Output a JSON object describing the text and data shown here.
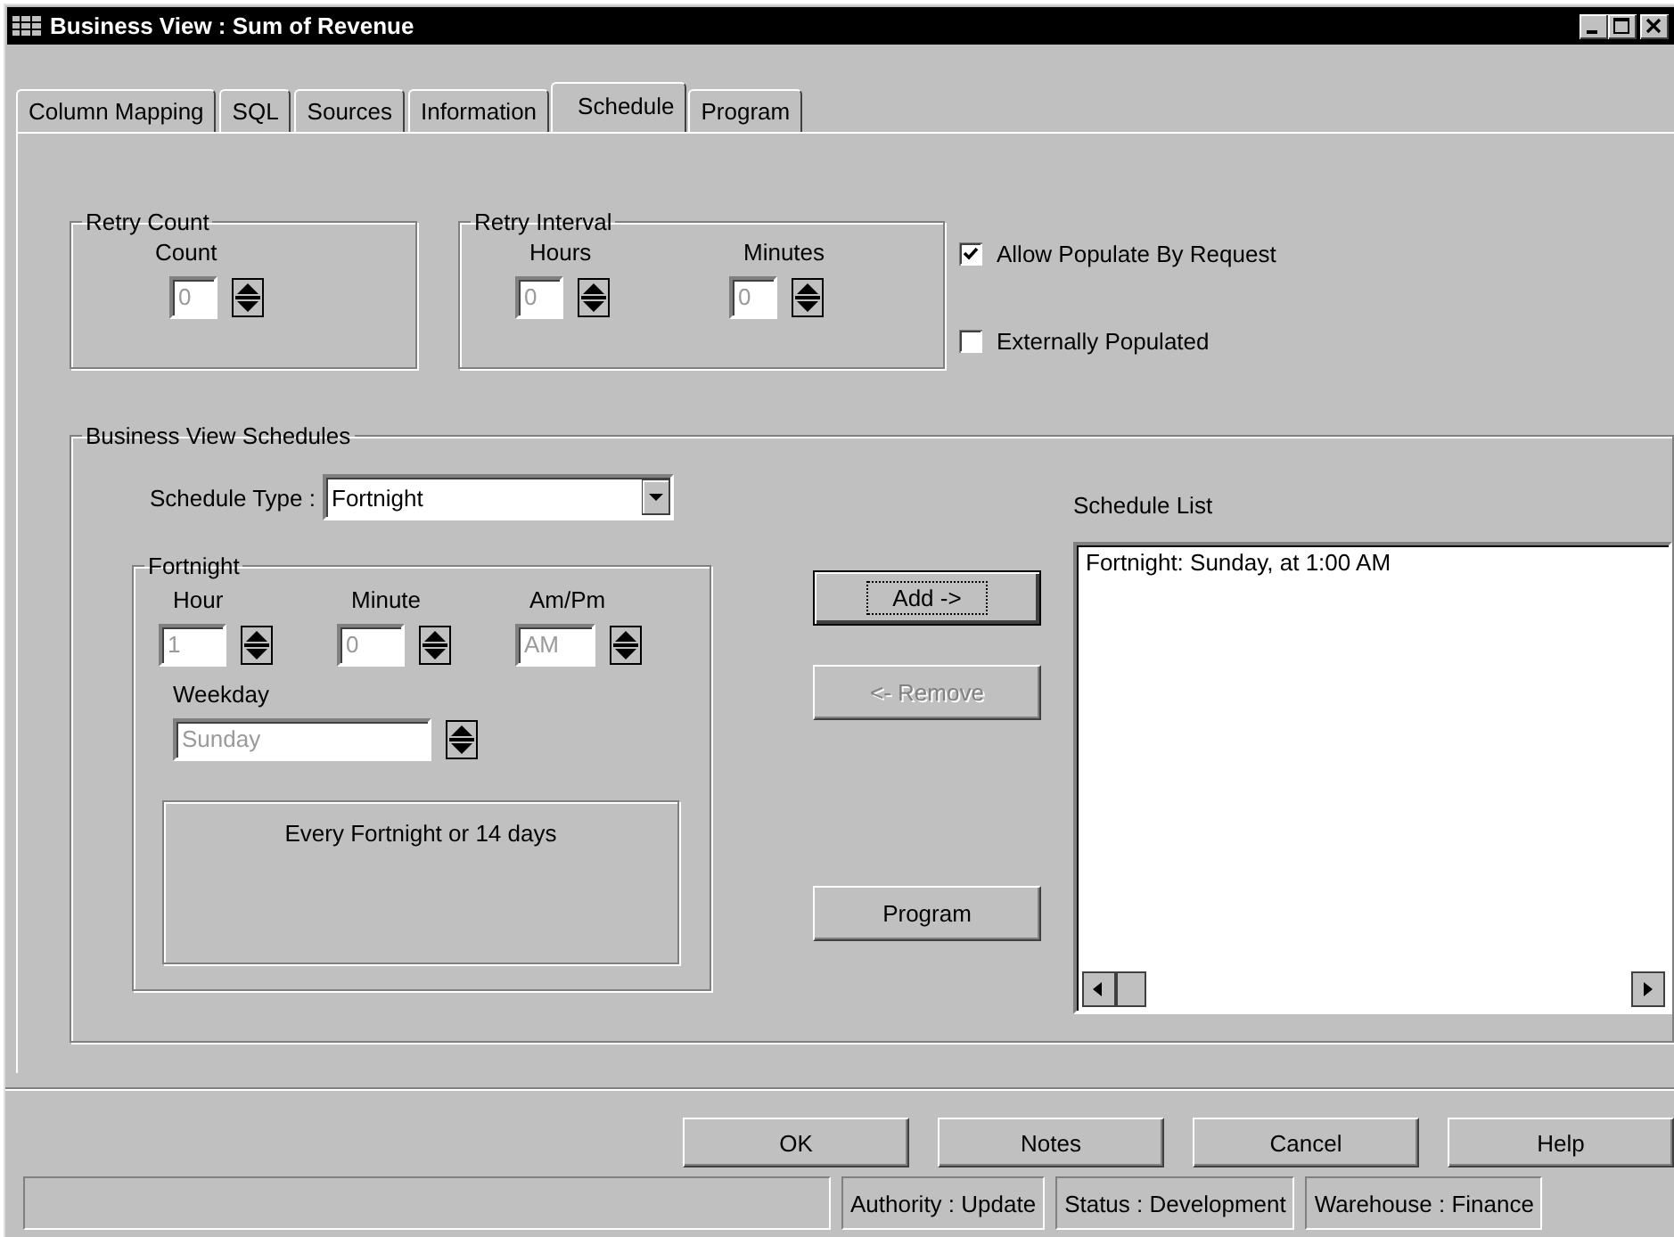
{
  "window": {
    "title": "Business View : Sum of Revenue"
  },
  "tabs": [
    {
      "label": "Column Mapping",
      "selected": false
    },
    {
      "label": "SQL",
      "selected": false
    },
    {
      "label": "Sources",
      "selected": false
    },
    {
      "label": "Information",
      "selected": false
    },
    {
      "label": "Schedule",
      "selected": true
    },
    {
      "label": "Program",
      "selected": false
    }
  ],
  "retry_count": {
    "title": "Retry Count",
    "fields": [
      {
        "label": "Count",
        "value": "0",
        "disabled": true
      }
    ]
  },
  "retry_interval": {
    "title": "Retry Interval",
    "fields": [
      {
        "label": "Hours",
        "value": "0",
        "disabled": true
      },
      {
        "label": "Minutes",
        "value": "0",
        "disabled": true
      }
    ]
  },
  "options": [
    {
      "label": "Allow Populate By Request",
      "checked": true
    },
    {
      "label": "Externally Populated",
      "checked": false
    }
  ],
  "schedules": {
    "title": "Business View Schedules",
    "schedule_type": {
      "label": "Schedule Type :",
      "value": "Fortnight"
    },
    "detail": {
      "title": "Fortnight",
      "fields": [
        {
          "label": "Hour",
          "value": "1",
          "disabled": true
        },
        {
          "label": "Minute",
          "value": "0",
          "disabled": true
        },
        {
          "label": "Am/Pm",
          "value": "AM",
          "disabled": true
        }
      ],
      "weekday": {
        "label": "Weekday",
        "value": "Sunday",
        "disabled": true
      },
      "description": "Every Fortnight or 14 days"
    },
    "buttons": [
      {
        "label": "Add ->",
        "disabled": false,
        "focused": true
      },
      {
        "label": "<- Remove",
        "disabled": true,
        "focused": false
      },
      {
        "label": "Program",
        "disabled": false,
        "focused": false
      }
    ],
    "list": {
      "label": "Schedule List",
      "items": [
        "Fortnight: Sunday, at 1:00 AM"
      ]
    }
  },
  "buttons": [
    "OK",
    "Notes",
    "Cancel",
    "Help"
  ],
  "status_bar": [
    "Authority : Update",
    "Status : Development",
    "Warehouse : Finance"
  ]
}
